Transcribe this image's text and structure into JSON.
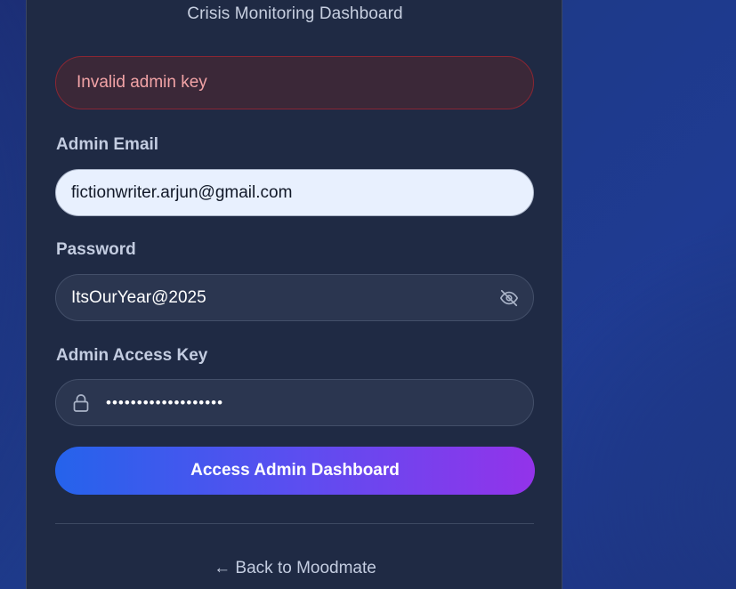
{
  "header": {
    "subtitle": "Crisis Monitoring Dashboard"
  },
  "alert": {
    "message": "Invalid admin key",
    "colors": {
      "background": "#3b2838",
      "border": "#8a2633",
      "text": "#f2a3a6"
    }
  },
  "form": {
    "email": {
      "label": "Admin Email",
      "value": "fictionwriter.arjun@gmail.com"
    },
    "password": {
      "label": "Password",
      "value": "ItsOurYear@2025",
      "toggle_icon": "eye-off-icon"
    },
    "admin_key": {
      "label": "Admin Access Key",
      "value": "•••••••••••••••••••",
      "icon": "lock-icon"
    },
    "submit_label": "Access Admin Dashboard"
  },
  "footer": {
    "back_link": "← Back to Moodmate"
  },
  "colors": {
    "card": "#1f2a44",
    "accent_start": "#2563eb",
    "accent_end": "#9333ea"
  }
}
